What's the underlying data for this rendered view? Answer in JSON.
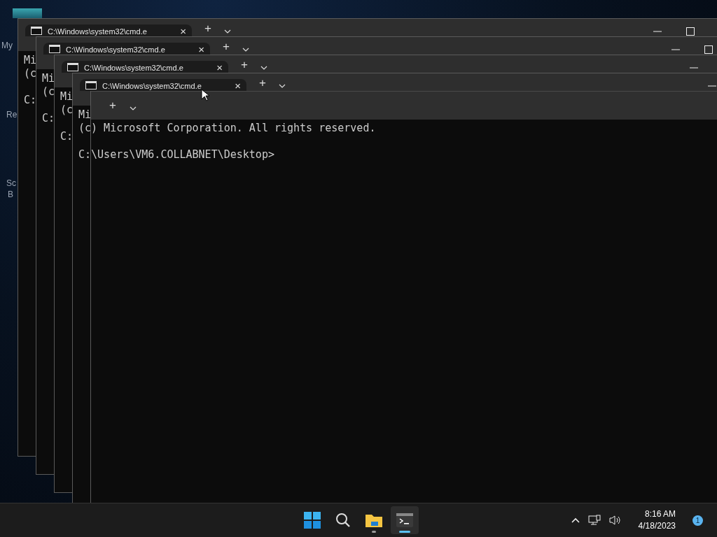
{
  "desktop": {
    "icon_labels": [
      "My",
      "Re",
      "Sc",
      "B"
    ]
  },
  "windows": [
    {
      "tab": {
        "title": "C:\\Windows\\system32\\cmd.e",
        "close": "×"
      },
      "new_tab": "+",
      "controls": [
        {
          "kind": "minimize"
        },
        {
          "kind": "maximize"
        }
      ],
      "header": [
        "Mi",
        "(c"
      ],
      "prompt": "C:"
    },
    {
      "tab": {
        "title": "C:\\Windows\\system32\\cmd.e",
        "close": "×"
      },
      "new_tab": "+",
      "controls": [
        {
          "kind": "minimize"
        },
        {
          "kind": "maximize"
        }
      ],
      "header": [
        "Mi",
        "(c"
      ],
      "prompt": "C:"
    },
    {
      "tab": {
        "title": "C:\\Windows\\system32\\cmd.e",
        "close": "×"
      },
      "new_tab": "+",
      "controls": [
        {
          "kind": "minimize"
        }
      ],
      "header": [
        "Mi",
        "(c"
      ],
      "prompt": "C:"
    },
    {
      "tab": {
        "title": "C:\\Windows\\system32\\cmd.e",
        "close": "×"
      },
      "new_tab": "+",
      "controls": [
        {
          "kind": "minimize"
        }
      ],
      "header": [
        "Mi",
        "(c) Microsoft Corporation. All rights reserved."
      ],
      "prompt": "C:\\Users\\VM6.COLLABNET\\Desktop>"
    }
  ],
  "top_frame": {
    "new_tab": "+"
  },
  "taskbar": {
    "apps": [
      {
        "kind": "start",
        "selected": false
      },
      {
        "kind": "search",
        "selected": false
      },
      {
        "kind": "explorer",
        "selected": false
      },
      {
        "kind": "terminal",
        "selected": true
      }
    ],
    "time": "8:16 AM",
    "date": "4/18/2023",
    "notifications": "1"
  }
}
